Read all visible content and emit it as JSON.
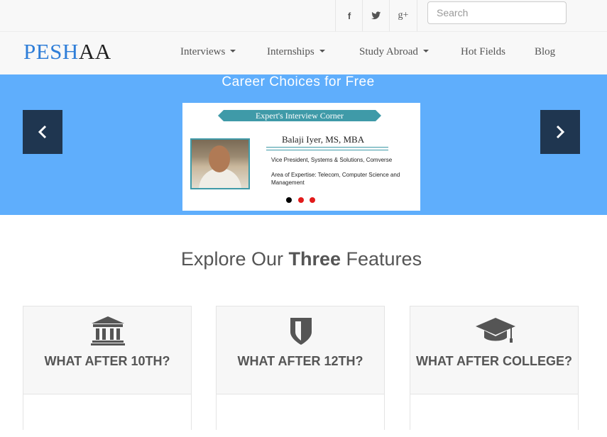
{
  "social": {
    "facebook": "f",
    "twitter": "twitter-icon",
    "googleplus": "g+"
  },
  "search": {
    "placeholder": "Search",
    "value": ""
  },
  "brand": {
    "part1": "PESH",
    "part2": "AA"
  },
  "nav": {
    "items": [
      {
        "label": "Interviews",
        "dropdown": true
      },
      {
        "label": "Internships",
        "dropdown": true
      },
      {
        "label": "Study Abroad",
        "dropdown": true
      },
      {
        "label": "Hot Fields",
        "dropdown": false
      },
      {
        "label": "Blog",
        "dropdown": false
      }
    ]
  },
  "hero": {
    "title": "Career Choices for Free",
    "slide": {
      "ribbon": "Expert's Interview Corner",
      "name": "Balaji Iyer, MS, MBA",
      "role": "Vice President, Systems & Solutions, Comverse",
      "area": "Area of Expertise: Telecom, Computer Science and Management"
    },
    "indicators": [
      "#000000",
      "#e21b1b",
      "#e21b1b"
    ]
  },
  "features": {
    "heading_pre": "Explore Our ",
    "heading_bold": "Three",
    "heading_post": " Features",
    "cards": [
      {
        "title": "WHAT AFTER 10TH?",
        "icon": "bank-icon"
      },
      {
        "title": "WHAT AFTER 12TH?",
        "icon": "shield-icon"
      },
      {
        "title": "WHAT AFTER COLLEGE?",
        "icon": "graduation-cap-icon"
      }
    ]
  },
  "colors": {
    "hero_bg": "#5faefc",
    "arrow_bg": "#1f3650",
    "brand_blue": "#2f7ed8",
    "ribbon": "#3f9aa8"
  }
}
